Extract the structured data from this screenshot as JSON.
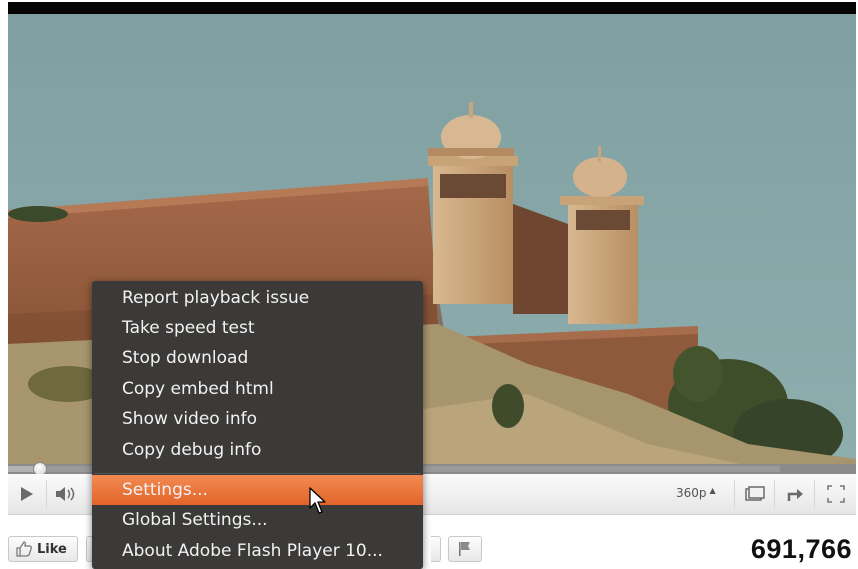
{
  "video": {
    "quality_label": "360p",
    "progress_fraction": 0.03,
    "loaded_fraction": 0.91
  },
  "context_menu": {
    "items": [
      {
        "label": "Report playback issue"
      },
      {
        "label": "Take speed test"
      },
      {
        "label": "Stop download"
      },
      {
        "label": "Copy embed html"
      },
      {
        "label": "Show video info"
      },
      {
        "label": "Copy debug info"
      },
      {
        "label": "Settings..."
      },
      {
        "label": "Global Settings..."
      },
      {
        "label": "About Adobe Flash Player 10..."
      }
    ],
    "highlighted_index": 6,
    "highlight_color": "#e9733b",
    "background_color": "#3b3a38"
  },
  "below_video": {
    "like_label": "Like",
    "view_count": "691,766"
  },
  "icons": {
    "play": "play-icon",
    "volume": "volume-icon",
    "popout": "popout-icon",
    "share": "share-arrow-icon",
    "fullscreen": "fullscreen-icon",
    "thumb": "thumbs-up-icon",
    "flag": "flag-icon",
    "cursor": "mouse-pointer-icon"
  }
}
